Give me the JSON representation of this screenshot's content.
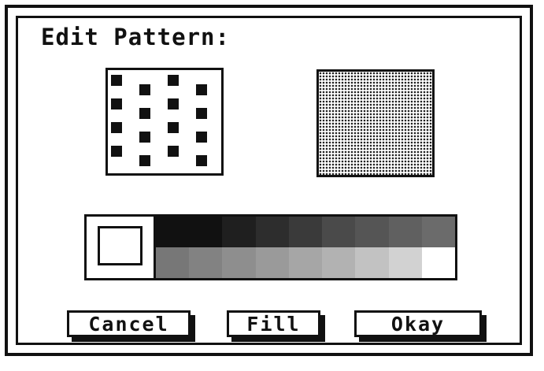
{
  "dialog": {
    "title": "Edit Pattern:"
  },
  "pattern_editor": {
    "grid_columns": 4,
    "grid_rows": 4
  },
  "palette": {
    "top_row_colors": [
      "#111111",
      "#111111",
      "#1f1f1f",
      "#2d2d2d",
      "#3a3a3a",
      "#4a4a4a",
      "#555555",
      "#606060",
      "#6b6b6b"
    ],
    "bottom_row_colors": [
      "#777777",
      "#828282",
      "#8e8e8e",
      "#9a9a9a",
      "#a6a6a6",
      "#b2b2b2",
      "#c2c2c2",
      "#d2d2d2",
      "#ffffff"
    ]
  },
  "buttons": {
    "cancel_label": "Cancel",
    "fill_label": "Fill",
    "okay_label": "Okay"
  }
}
